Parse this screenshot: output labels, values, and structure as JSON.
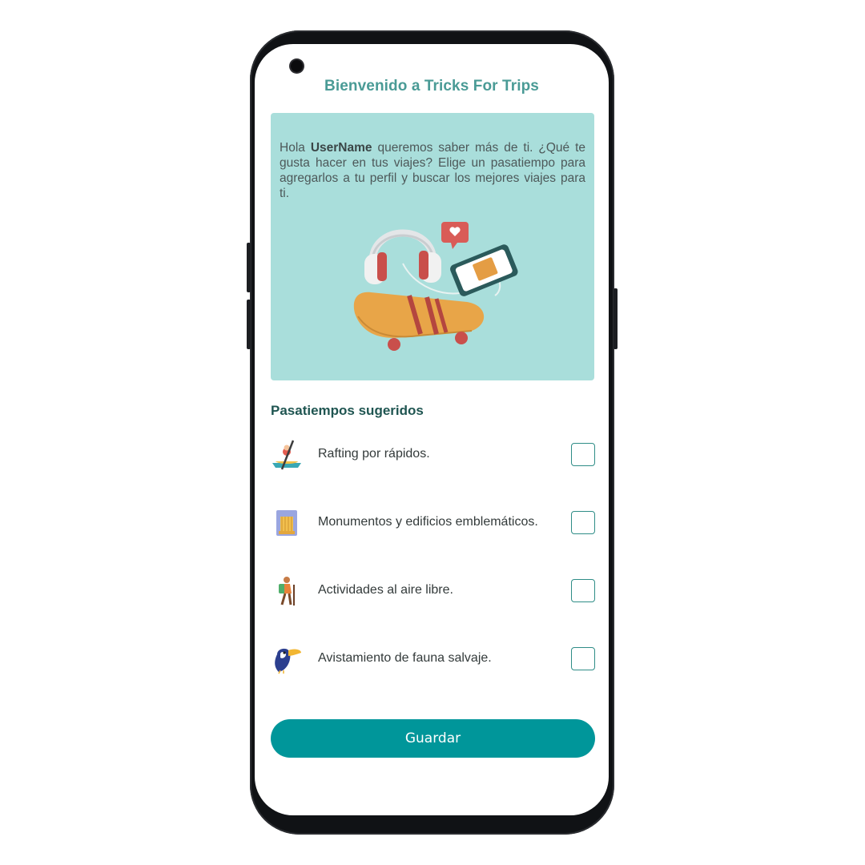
{
  "app": {
    "title": "Bienvenido a Tricks For Trips"
  },
  "intro": {
    "greeting": "Hola",
    "username": "UserName",
    "message": "queremos saber más de ti. ¿Qué te gusta hacer en tus viajes? Elige un pasatiempo para agregarlos a tu perfil y buscar los mejores viajes para ti."
  },
  "hobbies": {
    "title": "Pasatiempos sugeridos",
    "items": [
      {
        "label": "Rafting por rápidos.",
        "icon": "kayak-icon",
        "checked": false
      },
      {
        "label": "Monumentos y edificios emblemáticos.",
        "icon": "monument-icon",
        "checked": false
      },
      {
        "label": "Actividades al aire libre.",
        "icon": "hiker-icon",
        "checked": false
      },
      {
        "label": "Avistamiento de fauna salvaje.",
        "icon": "toucan-icon",
        "checked": false
      }
    ]
  },
  "actions": {
    "save_label": "Guardar"
  },
  "colors": {
    "accent": "#00969a",
    "title": "#4a9b96",
    "card_bg": "#a9dedb",
    "section_title": "#1f5551"
  }
}
